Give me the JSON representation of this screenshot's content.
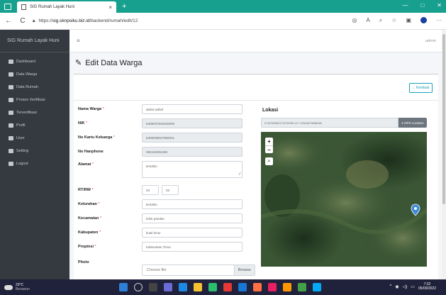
{
  "browser": {
    "tab_title": "SIG Rumah Layak Huni",
    "tab_close": "×",
    "new_tab": "+",
    "url_prefix": "https://",
    "url_host": "sig.sknpsiku.biz.id",
    "url_path": "/backend/rumah/edit/12",
    "nav_back": "←",
    "nav_reload": "C"
  },
  "app": {
    "brand": "SIG Rumah Layak Huni",
    "user": "admin",
    "page_title": "Edit Data Warga",
    "back_button": "Kembali"
  },
  "sidebar": {
    "items": [
      {
        "label": "Dashboard"
      },
      {
        "label": "Data Warga"
      },
      {
        "label": "Data Rumah"
      },
      {
        "label": "Proses Verifikasi"
      },
      {
        "label": "Terverifikasi"
      },
      {
        "label": "Profil"
      },
      {
        "label": "User"
      },
      {
        "label": "Setting"
      },
      {
        "label": "Logout"
      }
    ]
  },
  "form": {
    "nama_label": "Nama Warga",
    "nama_value": "abdul wahid",
    "nik_label": "NIK",
    "nik_value": "6408037846400005",
    "kk_label": "No Kartu Keluarga",
    "kk_value": "6408038027860001",
    "hp_label": "No Hanphone",
    "hp_value": "082152302459",
    "alamat_label": "Alamat",
    "alamat_value": "kendelo",
    "rtrw_label": "RT/RW",
    "rt_value": "03",
    "rw_value": "03",
    "kel_label": "Kelurahan",
    "kel_value": "kendelo",
    "kec_label": "Kecamatan",
    "kec_value": "teluk pandan",
    "kab_label": "Kabupaten",
    "kab_value": "kutai timur",
    "prov_label": "Propinsi",
    "prov_value": "Kalimantan Timur",
    "photo_label": "Photo",
    "file_placeholder": "Choose file",
    "browse": "Browse",
    "required_mark": "*"
  },
  "location": {
    "label": "Lokasi",
    "coords": "0.28769892173749999,117.47844673858265",
    "gps_button": "GPS Location",
    "zoom_in": "+",
    "zoom_out": "−"
  },
  "taskbar": {
    "temp": "23°C",
    "weather": "Berawan",
    "time": "7:22",
    "date": "05/09/2022"
  },
  "colors": {
    "browser_accent": "#18a08f",
    "sidebar_bg": "#343a40",
    "info": "#17a2b8",
    "required": "#dc3545"
  }
}
